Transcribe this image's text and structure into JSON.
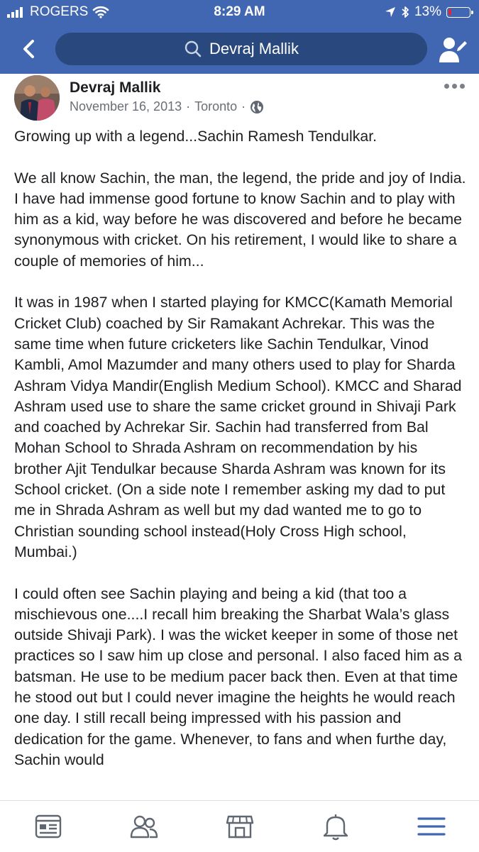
{
  "status": {
    "carrier": "ROGERS",
    "time": "8:29 AM",
    "battery": "13%",
    "battery_level": 0.13
  },
  "nav": {
    "search_text": "Devraj Mallik"
  },
  "post": {
    "author": "Devraj Mallik",
    "date": "November 16, 2013",
    "separator": "·",
    "location": "Toronto",
    "paragraphs": [
      "Growing up with a legend...Sachin Ramesh Tendulkar.",
      "We all know Sachin, the man, the legend, the pride and joy of India. I have had immense good fortune to know Sachin and to play with him as a kid, way before he was discovered and before he became synonymous with cricket. On his retirement, I would like to share a couple of memories of him...",
      "It was in 1987 when I started playing for KMCC(Kamath Memorial Cricket Club) coached by Sir Ramakant Achrekar. This was the same time when future cricketers like Sachin Tendulkar, Vinod Kambli, Amol Mazumder and many others used to play for Sharda Ashram Vidya Mandir(English Medium School). KMCC and Sharad Ashram used use to share the same cricket ground in Shivaji Park and coached by Achrekar Sir. Sachin had transferred from Bal Mohan School to Shrada Ashram on recommendation  by his brother Ajit Tendulkar because Sharda Ashram was known for its School cricket. (On a side note I remember asking my dad to put me in Shrada Ashram as well but my dad wanted me to go to Christian sounding school instead(Holy Cross High school, Mumbai.)",
      "I could often see Sachin playing and being a kid (that too a mischievous one....I recall him breaking the Sharbat Wala’s glass outside Shivaji Park). I was the wicket keeper in some of those net practices so I saw him up close and personal. I also faced him as a batsman. He use to be medium pacer back then. Even at that time he stood out but I could never imagine the heights he would reach one day. I still recall being impressed with his passion and dedication for the game. Whenever, to fans and when furthe day, Sachin would"
    ]
  },
  "tabbar": {
    "tabs": [
      "news-feed",
      "friends",
      "marketplace",
      "notifications",
      "menu"
    ],
    "active": "menu",
    "active_color": "#4267b2",
    "inactive_color": "#606770"
  },
  "colors": {
    "brand": "#4267b2",
    "search_bg": "#29487d",
    "battery_low": "#e0243a"
  }
}
